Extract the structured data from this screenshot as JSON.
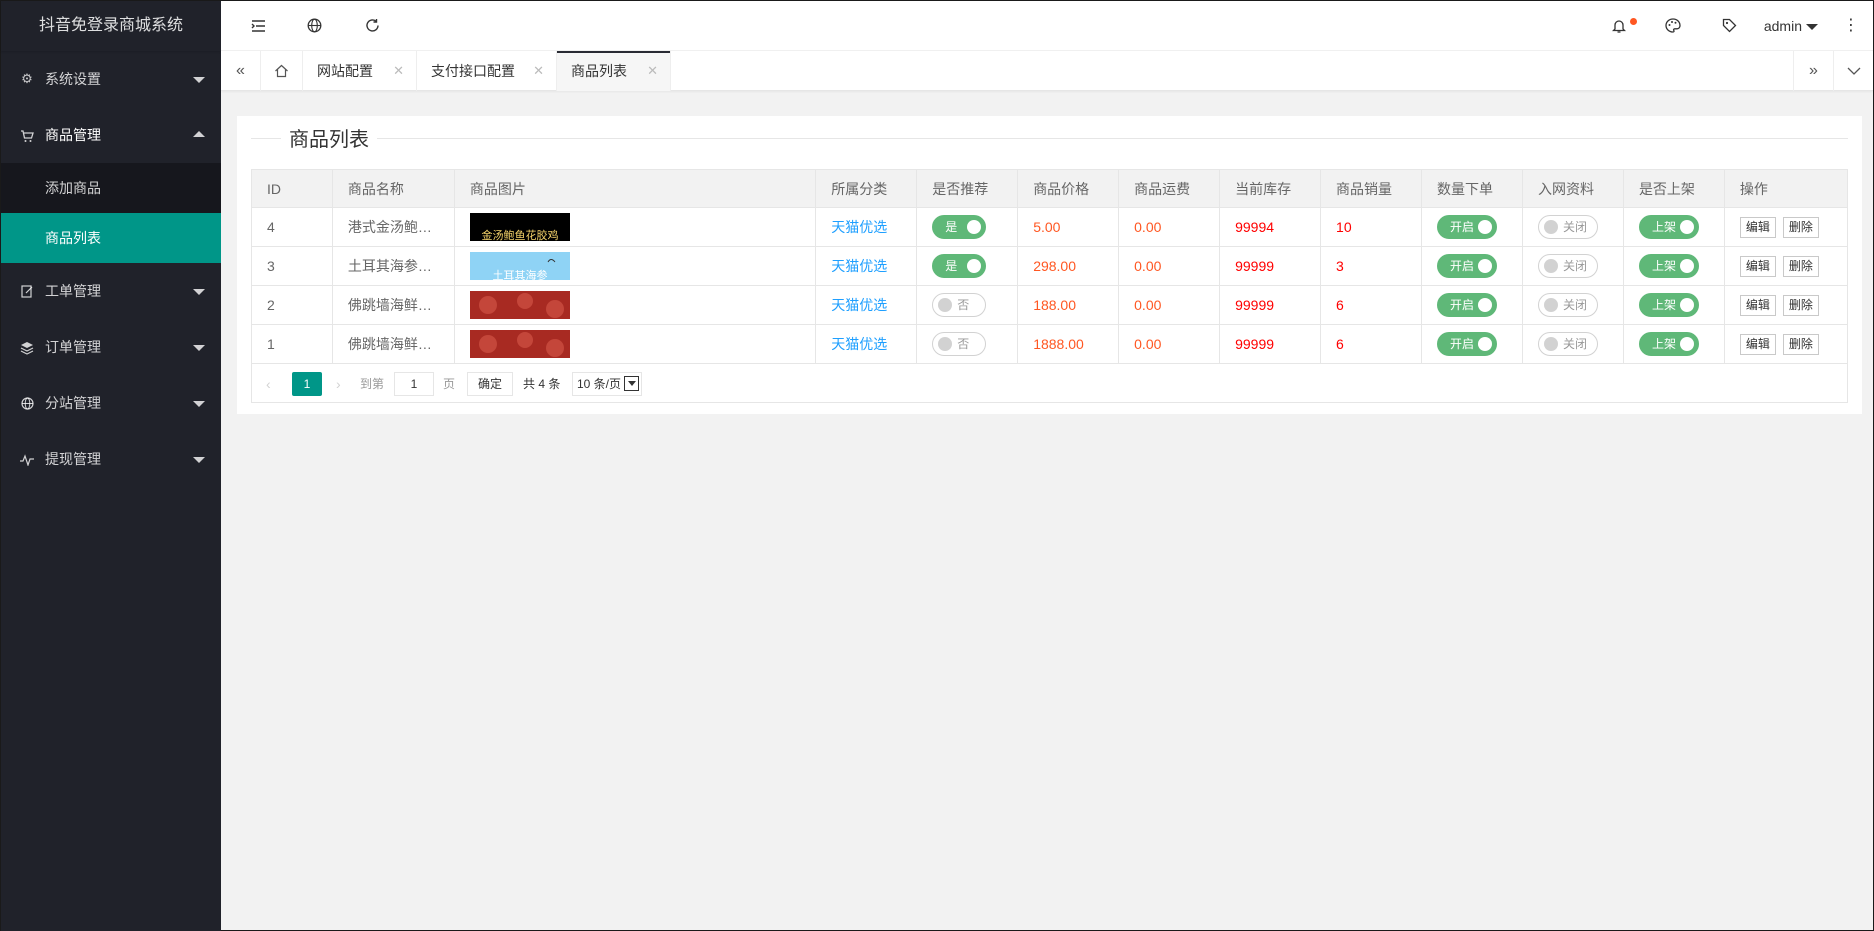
{
  "app": {
    "title": "抖音免登录商城系统"
  },
  "sidebar": {
    "items": [
      {
        "label": "系统设置",
        "icon": "gear-icon"
      },
      {
        "label": "商品管理",
        "icon": "cart-icon",
        "open": true,
        "children": [
          {
            "label": "添加商品"
          },
          {
            "label": "商品列表",
            "active": true
          }
        ]
      },
      {
        "label": "工单管理",
        "icon": "edit-icon"
      },
      {
        "label": "订单管理",
        "icon": "layers-icon"
      },
      {
        "label": "分站管理",
        "icon": "globe-icon"
      },
      {
        "label": "提现管理",
        "icon": "pulse-icon"
      }
    ]
  },
  "header": {
    "icons": [
      "menu-shrink-icon",
      "globe-icon",
      "refresh-icon",
      "bell-icon",
      "palette-icon",
      "tag-icon",
      "more-vertical-icon"
    ],
    "user": "admin"
  },
  "tabs": {
    "items": [
      {
        "label": "网站配置"
      },
      {
        "label": "支付接口配置"
      },
      {
        "label": "商品列表",
        "active": true
      }
    ]
  },
  "main": {
    "title": "商品列表",
    "table": {
      "headers": [
        "ID",
        "商品名称",
        "商品图片",
        "所属分类",
        "是否推荐",
        "商品价格",
        "商品运费",
        "当前库存",
        "商品销量",
        "数量下单",
        "入网资料",
        "是否上架",
        "操作"
      ],
      "rows": [
        {
          "id": "4",
          "name": "港式金汤鲍…",
          "image_text": "金汤鲍鱼花胶鸡",
          "category": "天猫优选",
          "recommend": "是",
          "recommend_on": true,
          "price": "5.00",
          "shipping": "0.00",
          "stock": "99994",
          "sales": "10",
          "qty_order": "开启",
          "net_info": "关闭",
          "on_shelf": "上架"
        },
        {
          "id": "3",
          "name": "土耳其海参…",
          "image_text": "土耳其海参",
          "category": "天猫优选",
          "recommend": "是",
          "recommend_on": true,
          "price": "298.00",
          "shipping": "0.00",
          "stock": "99999",
          "sales": "3",
          "qty_order": "开启",
          "net_info": "关闭",
          "on_shelf": "上架"
        },
        {
          "id": "2",
          "name": "佛跳墙海鲜…",
          "image_text": "",
          "category": "天猫优选",
          "recommend": "否",
          "recommend_on": false,
          "price": "188.00",
          "shipping": "0.00",
          "stock": "99999",
          "sales": "6",
          "qty_order": "开启",
          "net_info": "关闭",
          "on_shelf": "上架"
        },
        {
          "id": "1",
          "name": "佛跳墙海鲜…",
          "image_text": "",
          "category": "天猫优选",
          "recommend": "否",
          "recommend_on": false,
          "price": "1888.00",
          "shipping": "0.00",
          "stock": "99999",
          "sales": "6",
          "qty_order": "开启",
          "net_info": "关闭",
          "on_shelf": "上架"
        }
      ],
      "actions": {
        "edit": "编辑",
        "delete": "删除"
      }
    },
    "pagination": {
      "current": "1",
      "goto_label": "到第",
      "goto_value": "1",
      "page_unit": "页",
      "confirm": "确定",
      "total": "共 4 条",
      "page_size": "10 条/页"
    }
  },
  "colors": {
    "sidebar_bg": "#20222a",
    "accent": "#009688",
    "switch_on": "#5fb878",
    "link": "#1e9fff",
    "price": "#ff5722",
    "stock": "#ff0000"
  }
}
